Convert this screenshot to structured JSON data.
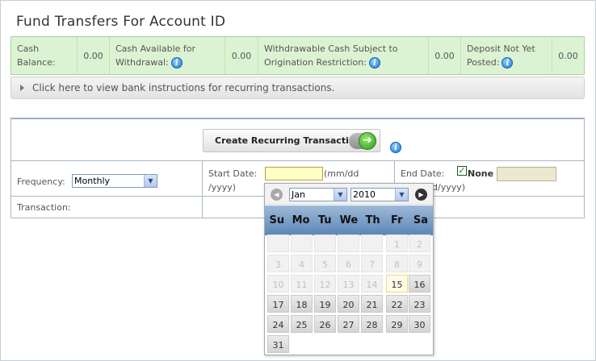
{
  "page": {
    "title": "Fund Transfers For Account ID"
  },
  "balances": {
    "cash_balance_label": "Cash Balance:",
    "cash_balance_value": "0.00",
    "cash_available_label": "Cash Available for Withdrawal:",
    "cash_available_value": "0.00",
    "withdrawable_label": "Withdrawable Cash Subject to Origination Restriction:",
    "withdrawable_value": "0.00",
    "deposit_label": "Deposit Not Yet Posted:",
    "deposit_value": "0.00"
  },
  "instructions_link": "Click here to view bank instructions for recurring transactions.",
  "form": {
    "create_button_label": "Create Recurring Transaction",
    "frequency_label": "Frequency:",
    "frequency_value": "Monthly",
    "start_date_label": "Start Date:",
    "start_date_hint_a": "(mm/dd",
    "start_date_hint_b": "/yyyy)",
    "end_date_label": "End Date:",
    "end_none_label": "None",
    "end_hint": "d/yyyy)",
    "transaction_label": "Transaction:"
  },
  "calendar": {
    "month": "Jan",
    "year": "2010",
    "weekdays": [
      "Su",
      "Mo",
      "Tu",
      "We",
      "Th",
      "Fr",
      "Sa"
    ],
    "weeks": [
      [
        {
          "d": "",
          "t": "out"
        },
        {
          "d": "",
          "t": "out"
        },
        {
          "d": "",
          "t": "out"
        },
        {
          "d": "",
          "t": "out"
        },
        {
          "d": "",
          "t": "out"
        },
        {
          "d": "1",
          "t": "out"
        },
        {
          "d": "2",
          "t": "out"
        }
      ],
      [
        {
          "d": "3",
          "t": "out"
        },
        {
          "d": "4",
          "t": "out"
        },
        {
          "d": "5",
          "t": "out"
        },
        {
          "d": "6",
          "t": "out"
        },
        {
          "d": "7",
          "t": "out"
        },
        {
          "d": "8",
          "t": "out"
        },
        {
          "d": "9",
          "t": "out"
        }
      ],
      [
        {
          "d": "10",
          "t": "out"
        },
        {
          "d": "11",
          "t": "out"
        },
        {
          "d": "12",
          "t": "out"
        },
        {
          "d": "13",
          "t": "out"
        },
        {
          "d": "14",
          "t": "out"
        },
        {
          "d": "15",
          "t": "today"
        },
        {
          "d": "16",
          "t": "in"
        }
      ],
      [
        {
          "d": "17",
          "t": "in"
        },
        {
          "d": "18",
          "t": "in"
        },
        {
          "d": "19",
          "t": "in"
        },
        {
          "d": "20",
          "t": "in"
        },
        {
          "d": "21",
          "t": "in"
        },
        {
          "d": "22",
          "t": "in"
        },
        {
          "d": "23",
          "t": "in"
        }
      ],
      [
        {
          "d": "24",
          "t": "in"
        },
        {
          "d": "25",
          "t": "in"
        },
        {
          "d": "26",
          "t": "in"
        },
        {
          "d": "27",
          "t": "in"
        },
        {
          "d": "28",
          "t": "in"
        },
        {
          "d": "29",
          "t": "in"
        },
        {
          "d": "30",
          "t": "in"
        }
      ],
      [
        {
          "d": "31",
          "t": "in"
        }
      ]
    ]
  }
}
